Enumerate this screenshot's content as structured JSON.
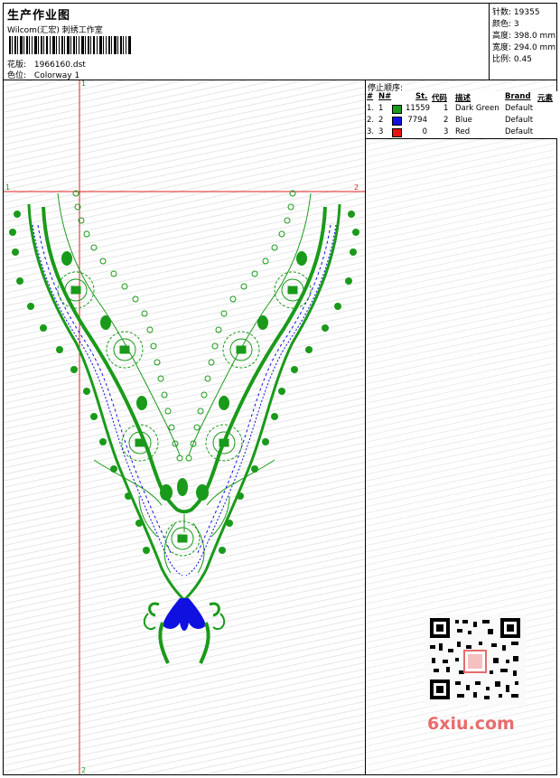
{
  "header": {
    "title": "生产作业图",
    "studio": "Wilcom(汇宏) 刺绣工作室",
    "design_label": "花版:",
    "design_file": "1966160.dst",
    "colorway_label": "色位:",
    "colorway": "Colorway 1"
  },
  "stats": {
    "stitches_label": "针数:",
    "stitches": "19355",
    "colors_label": "颜色:",
    "colors": "3",
    "height_label": "高度:",
    "height": "398.0 mm",
    "width_label": "宽度:",
    "width": "294.0 mm",
    "scale_label": "比例:",
    "scale": "0.45"
  },
  "guides": {
    "v_top": "1",
    "v_bottom": "2",
    "h_left": "1",
    "h_right": "2"
  },
  "stop_sequence": {
    "title": "停止顺序:",
    "headers": {
      "num": "#",
      "n": "N#",
      "st": "St.",
      "code": "代码",
      "desc": "描述",
      "brand": "Brand",
      "elem": "元素"
    },
    "rows": [
      {
        "num": "1.",
        "n": "1",
        "color": "#1a9a1a",
        "st": "11559",
        "code": "1",
        "desc": "Dark Green",
        "brand": "Default"
      },
      {
        "num": "2.",
        "n": "2",
        "color": "#1010e0",
        "st": "7794",
        "code": "2",
        "desc": "Blue",
        "brand": "Default"
      },
      {
        "num": "3.",
        "n": "3",
        "color": "#e81010",
        "st": "0",
        "code": "3",
        "desc": "Red",
        "brand": "Default"
      }
    ]
  },
  "watermark": {
    "site": "6xiu.com"
  },
  "colors": {
    "green": "#1a9a1a",
    "blue": "#1010e0",
    "guide": "#e02020"
  }
}
